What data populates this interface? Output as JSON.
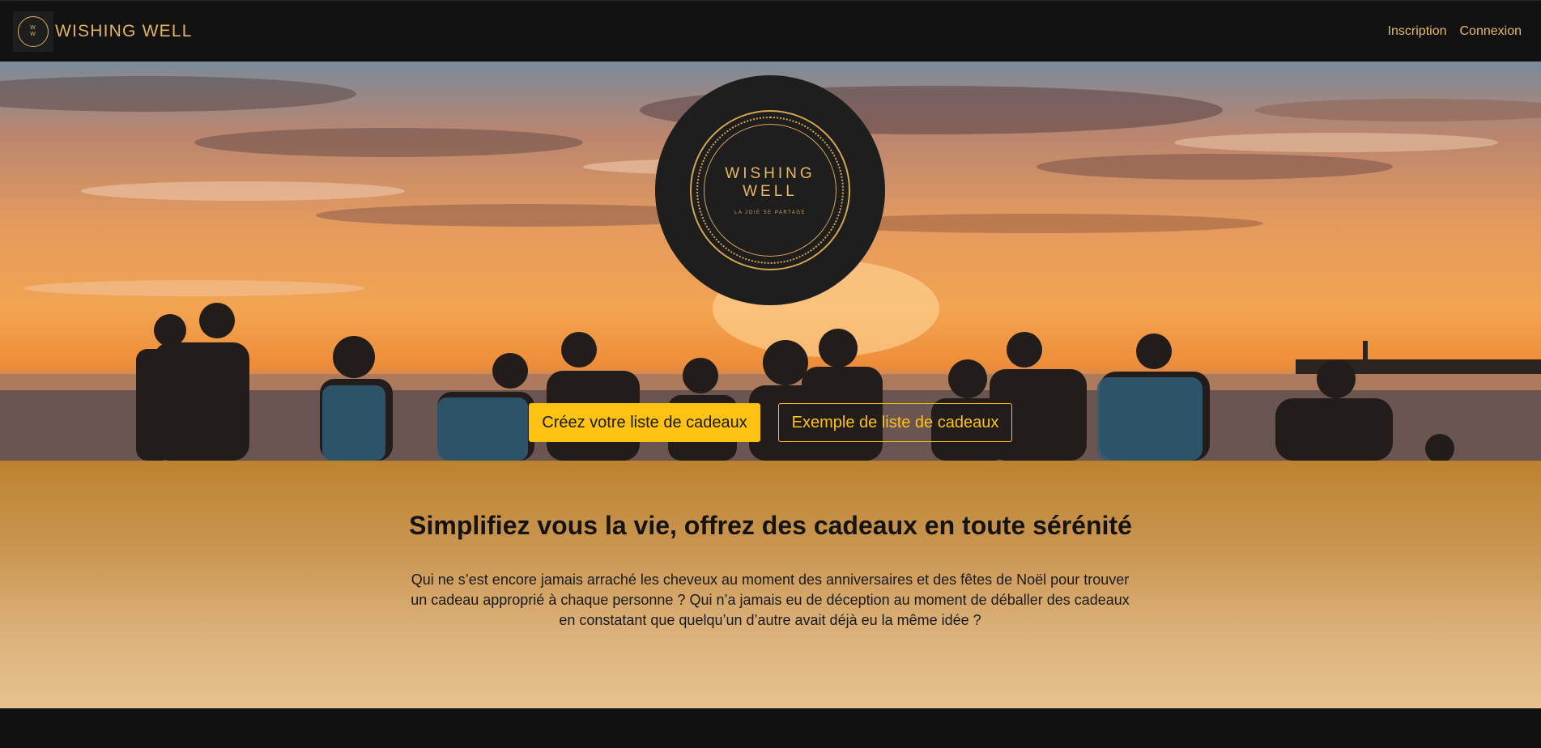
{
  "navbar": {
    "brand_mark": "W W",
    "brand_name": "WISHING WELL",
    "links": [
      "Inscription",
      "Connexion"
    ]
  },
  "hero": {
    "emblem_title_line1": "WISHING",
    "emblem_title_line2": "WELL",
    "emblem_tagline": "LA JOIE SE PARTAGE",
    "primary_button": "Créez votre liste de cadeaux",
    "secondary_button": "Exemple de liste de cadeaux"
  },
  "intro": {
    "heading": "Simplifiez vous la vie, offrez des cadeaux en toute sérénité",
    "paragraph": "Qui ne s’est encore jamais arraché les cheveux au moment des anniversaires et des fêtes de Noël pour trouver un cadeau approprié à chaque personne ? Qui n’a jamais eu de déception au moment de déballer des cadeaux en constatant que quelqu’un d’autre avait déjà eu la même idée ?"
  },
  "colors": {
    "accent": "#fdc212",
    "gold": "#e1b464",
    "dark": "#121212"
  }
}
